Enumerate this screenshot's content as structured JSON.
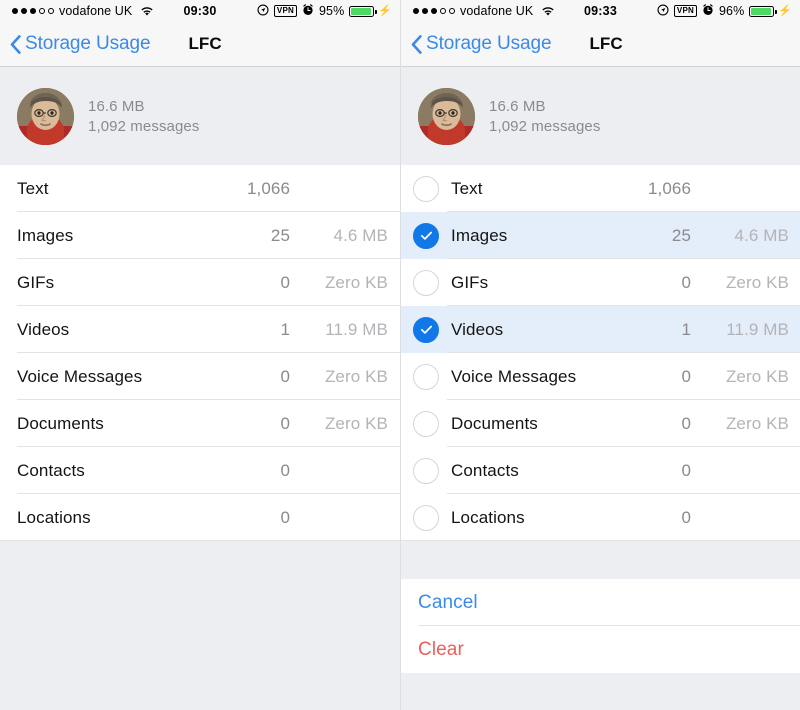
{
  "panels": [
    {
      "id": "left",
      "status": {
        "signal_filled": 3,
        "signal_empty": 2,
        "carrier": "vodafone UK",
        "wifi_icon": "wifi-icon",
        "time": "09:30",
        "location_icon": "location-arrow-icon",
        "vpn_label": "VPN",
        "alarm_icon": "alarm-clock-icon",
        "battery_pct": "95%",
        "battery_level": 95,
        "charging_icon": "lightning-bolt-icon"
      },
      "nav": {
        "back_icon": "chevron-left-icon",
        "back_label": "Storage Usage",
        "title": "LFC"
      },
      "profile": {
        "avatar_icon": "user-avatar-photo",
        "size": "16.6 MB",
        "messages": "1,092 messages"
      },
      "selection_mode": false,
      "rows": [
        {
          "label": "Text",
          "count": "1,066",
          "size": "",
          "selected": false
        },
        {
          "label": "Images",
          "count": "25",
          "size": "4.6 MB",
          "selected": false
        },
        {
          "label": "GIFs",
          "count": "0",
          "size": "Zero KB",
          "selected": false
        },
        {
          "label": "Videos",
          "count": "1",
          "size": "11.9 MB",
          "selected": false
        },
        {
          "label": "Voice Messages",
          "count": "0",
          "size": "Zero KB",
          "selected": false
        },
        {
          "label": "Documents",
          "count": "0",
          "size": "Zero KB",
          "selected": false
        },
        {
          "label": "Contacts",
          "count": "0",
          "size": "",
          "selected": false
        },
        {
          "label": "Locations",
          "count": "0",
          "size": "",
          "selected": false
        }
      ],
      "sheet": null
    },
    {
      "id": "right",
      "status": {
        "signal_filled": 3,
        "signal_empty": 2,
        "carrier": "vodafone UK",
        "wifi_icon": "wifi-icon",
        "time": "09:33",
        "location_icon": "location-arrow-icon",
        "vpn_label": "VPN",
        "alarm_icon": "alarm-clock-icon",
        "battery_pct": "96%",
        "battery_level": 96,
        "charging_icon": "lightning-bolt-icon"
      },
      "nav": {
        "back_icon": "chevron-left-icon",
        "back_label": "Storage Usage",
        "title": "LFC"
      },
      "profile": {
        "avatar_icon": "user-avatar-photo",
        "size": "16.6 MB",
        "messages": "1,092 messages"
      },
      "selection_mode": true,
      "rows": [
        {
          "label": "Text",
          "count": "1,066",
          "size": "",
          "selected": false
        },
        {
          "label": "Images",
          "count": "25",
          "size": "4.6 MB",
          "selected": true
        },
        {
          "label": "GIFs",
          "count": "0",
          "size": "Zero KB",
          "selected": false
        },
        {
          "label": "Videos",
          "count": "1",
          "size": "11.9 MB",
          "selected": true
        },
        {
          "label": "Voice Messages",
          "count": "0",
          "size": "Zero KB",
          "selected": false
        },
        {
          "label": "Documents",
          "count": "0",
          "size": "Zero KB",
          "selected": false
        },
        {
          "label": "Contacts",
          "count": "0",
          "size": "",
          "selected": false
        },
        {
          "label": "Locations",
          "count": "0",
          "size": "",
          "selected": false
        }
      ],
      "sheet": {
        "cancel_label": "Cancel",
        "clear_label": "Clear"
      }
    }
  ],
  "colors": {
    "accent_blue": "#1278e8",
    "link_blue": "#3b8ae8",
    "destructive_red": "#e8605c",
    "battery_green": "#4cd964",
    "selected_row": "#e4edfa",
    "page_background": "#eceef1"
  }
}
